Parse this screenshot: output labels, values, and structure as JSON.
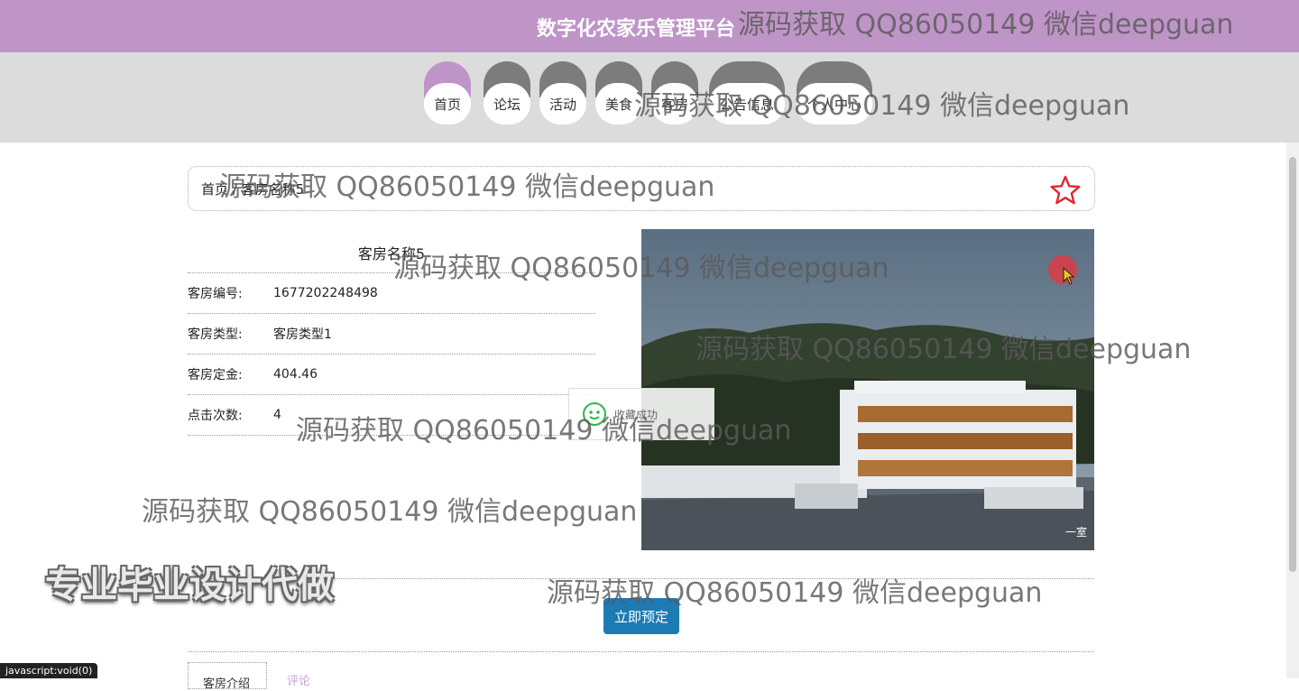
{
  "header": {
    "title": "数字化农家乐管理平台"
  },
  "nav": {
    "items": [
      {
        "label": "首页",
        "active": true
      },
      {
        "label": "论坛"
      },
      {
        "label": "活动"
      },
      {
        "label": "美食"
      },
      {
        "label": "客房"
      },
      {
        "label": "公告信息"
      },
      {
        "label": "个人中心"
      }
    ]
  },
  "breadcrumb": {
    "text": "首页 / 客房名称5"
  },
  "room": {
    "title": "客房名称5",
    "fields": [
      {
        "label": "客房编号:",
        "value": "1677202248498"
      },
      {
        "label": "客房类型:",
        "value": "客房类型1"
      },
      {
        "label": "客房定金:",
        "value": "404.46"
      },
      {
        "label": "点击次数:",
        "value": "4"
      }
    ],
    "photo_caption": "一室"
  },
  "toast": {
    "text": "收藏成功"
  },
  "actions": {
    "book_label": "立即预定"
  },
  "tabs": {
    "detail_label": "客房介绍",
    "review_label": "评论"
  },
  "status_bar": {
    "text": "javascript:void(0)"
  },
  "watermarks": {
    "contact": "源码获取 QQ86050149 微信deepguan",
    "promo": "专业毕业设计代做"
  },
  "colors": {
    "header_bg": "#bf95c8",
    "nav_inactive": "#7c7c7c",
    "button": "#1c7bb3",
    "star": "#e0262d"
  },
  "icons": {
    "favorite": "star-outline-icon",
    "toast": "wechat-icon"
  }
}
